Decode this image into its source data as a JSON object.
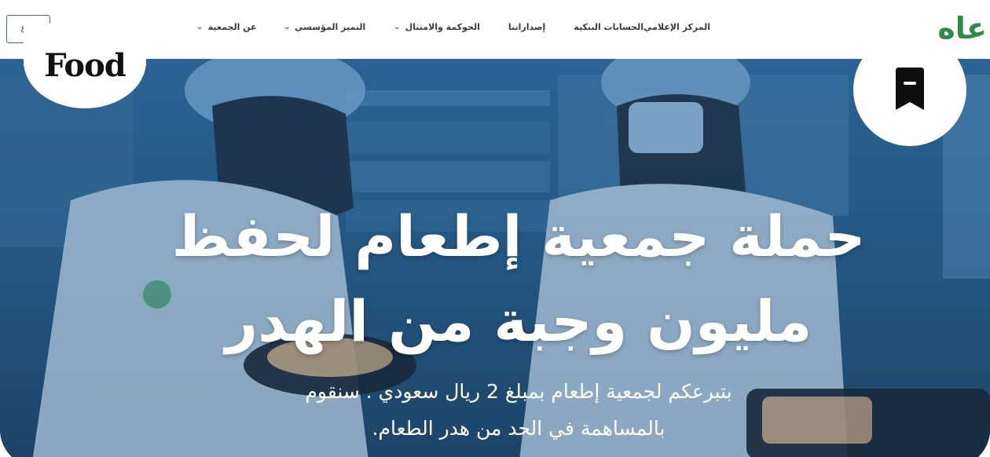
{
  "header": {
    "logo_text": "عاه",
    "nav": [
      {
        "label": "عن الجمعية",
        "has_dropdown": true
      },
      {
        "label": "التميز المؤسسي",
        "has_dropdown": true
      },
      {
        "label": "الحوكمة والامتثال",
        "has_dropdown": true
      },
      {
        "label": "إصداراتنا",
        "has_dropdown": false
      },
      {
        "label": "الحسابات البنكية",
        "has_dropdown": false
      },
      {
        "label": "المركز الإعلامي",
        "has_dropdown": false
      }
    ],
    "donate_label": "تبرع"
  },
  "hero": {
    "title_line1": "حملة جمعية إطعام لحفظ",
    "title_line2": "مليون وجبة من الهدر",
    "subtitle_line1": "بتبرعكم لجمعية إطعام بمبلغ 2 ريال سعودي . سنقوم",
    "subtitle_line2": "بالمساهمة في الحد من هدر الطعام."
  },
  "badges": {
    "food_label": "Food",
    "bookmark_icon": "bookmark-icon"
  },
  "colors": {
    "brand_green": "#2e8b45",
    "donate_border": "#2f6fb3",
    "hero_overlay": "#1f4f7a"
  }
}
